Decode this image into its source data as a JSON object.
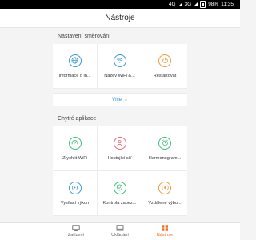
{
  "status_bar": {
    "network1": "4G",
    "network2": "3G",
    "battery": "98%",
    "time": "11:35"
  },
  "header": {
    "title": "Nástroje"
  },
  "sections": [
    {
      "title": "Nastavení směrování",
      "items": [
        {
          "label": "Informace o in...",
          "icon": "globe-icon",
          "color": "#3a9ad9"
        },
        {
          "label": "Název WiFi &...",
          "icon": "wifi-icon",
          "color": "#3a9ad9"
        },
        {
          "label": "Restartovat",
          "icon": "power-icon",
          "color": "#f29a3b"
        }
      ],
      "more_label": "Více"
    },
    {
      "title": "Chytré aplikace",
      "items": [
        {
          "label": "Zrychlit WiFi",
          "icon": "speedometer-icon",
          "color": "#3cbf7a"
        },
        {
          "label": "Hostující síť",
          "icon": "guest-user-icon",
          "color": "#e86b7c"
        },
        {
          "label": "Harmonogram...",
          "icon": "alarm-clock-icon",
          "color": "#3cbf7a"
        },
        {
          "label": "Vysílací výkon",
          "icon": "signal-power-icon",
          "color": "#3a9ad9"
        },
        {
          "label": "Kontrola zabez...",
          "icon": "shield-icon",
          "color": "#3cbf7a"
        },
        {
          "label": "Vzdálené výbu...",
          "icon": "remote-icon",
          "color": "#f29a3b"
        }
      ]
    }
  ],
  "tab_bar": {
    "tabs": [
      {
        "label": "Zařízení",
        "icon": "monitor-icon",
        "active": false
      },
      {
        "label": "Ukládání",
        "icon": "storage-icon",
        "active": false
      },
      {
        "label": "Nástroje",
        "icon": "tools-grid-icon",
        "active": true
      }
    ],
    "active_color": "#f26b1d"
  }
}
